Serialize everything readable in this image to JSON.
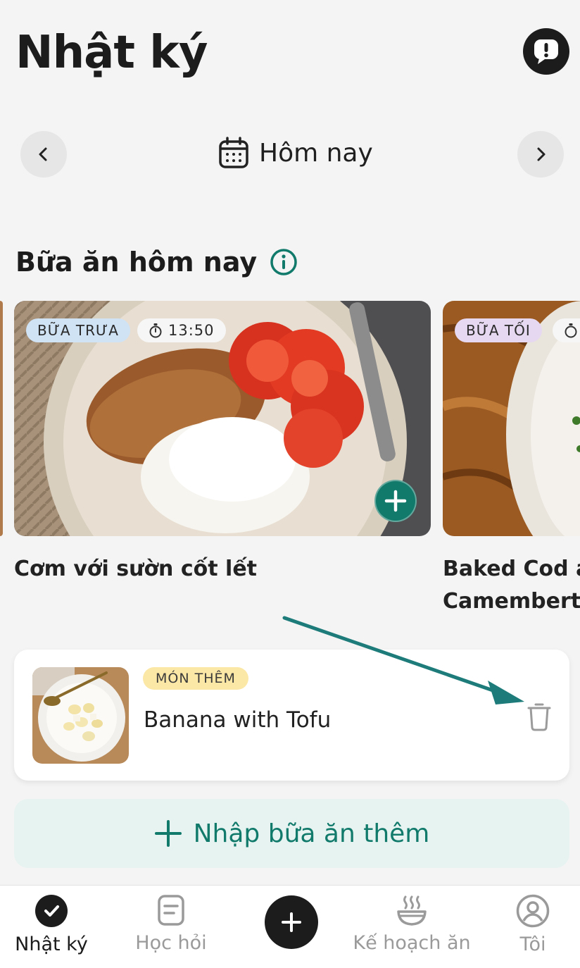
{
  "header": {
    "title": "Nhật ký"
  },
  "date_nav": {
    "label": "Hôm nay"
  },
  "meals_section": {
    "title": "Bữa ăn hôm nay"
  },
  "meals": [
    {
      "badge": "BỮA TRƯA",
      "time": "13:50",
      "name": "Cơm với sườn cốt lết"
    },
    {
      "badge": "BỮA TỐI",
      "name_line1": "Baked Cod ar",
      "name_line2": "Camembert ("
    }
  ],
  "extra": {
    "badge": "MÓN THÊM",
    "name": "Banana with Tofu"
  },
  "add_extra": {
    "label": "Nhập bữa ăn thêm"
  },
  "bottom_nav": {
    "diary": "Nhật ký",
    "learn": "Học hỏi",
    "plan": "Kế hoạch ăn",
    "me": "Tôi"
  },
  "colors": {
    "accent": "#117a6b",
    "arrow": "#1d7c7a",
    "dark": "#1c1c1c"
  }
}
